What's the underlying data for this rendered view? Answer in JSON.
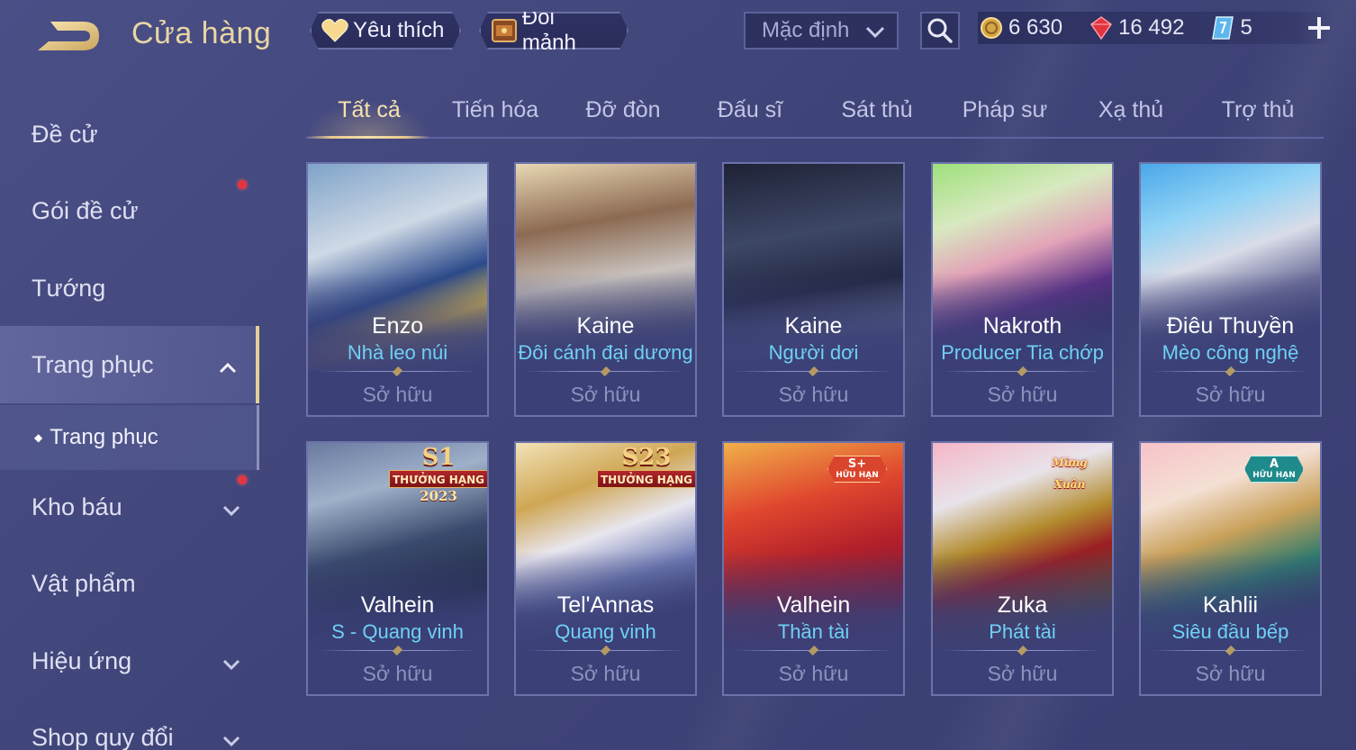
{
  "header": {
    "title": "Cửa hàng",
    "favorite_label": "Yêu thích",
    "exchange_label": "Đổi mảnh",
    "sort_selected": "Mặc định",
    "currencies": [
      {
        "icon": "gold-coin-icon",
        "value": "6 630"
      },
      {
        "icon": "red-gem-icon",
        "value": "16 492"
      },
      {
        "icon": "ticket-icon",
        "value": "5"
      }
    ]
  },
  "sidebar": {
    "items": [
      {
        "label": "Đề cử",
        "has_dot": false
      },
      {
        "label": "Gói đề cử",
        "has_dot": true
      },
      {
        "label": "Tướng",
        "has_dot": false
      },
      {
        "label": "Trang phục",
        "has_dot": false,
        "expanded": true,
        "active": true
      },
      {
        "label": "Kho báu",
        "has_dot": true
      },
      {
        "label": "Vật phẩm",
        "has_dot": false
      },
      {
        "label": "Hiệu ứng",
        "has_dot": false
      },
      {
        "label": "Shop quy đổi",
        "has_dot": false
      }
    ],
    "sub_item": "Trang phục"
  },
  "tabs": [
    "Tất cả",
    "Tiến hóa",
    "Đỡ đòn",
    "Đấu sĩ",
    "Sát thủ",
    "Pháp sư",
    "Xạ thủ",
    "Trợ thủ"
  ],
  "active_tab": 0,
  "cards": [
    {
      "hero": "Enzo",
      "skin": "Nhà leo núi",
      "status": "Sở hữu",
      "badge": null
    },
    {
      "hero": "Kaine",
      "skin": "Đôi cánh đại dương",
      "status": "Sở hữu",
      "badge": null
    },
    {
      "hero": "Kaine",
      "skin": "Người dơi",
      "status": "Sở hữu",
      "badge": null
    },
    {
      "hero": "Nakroth",
      "skin": "Producer Tia chớp",
      "status": "Sở hữu",
      "badge": null
    },
    {
      "hero": "Điêu Thuyền",
      "skin": "Mèo công nghệ",
      "status": "Sở hữu",
      "badge": null
    },
    {
      "hero": "Valhein",
      "skin": "S - Quang vinh",
      "status": "Sở hữu",
      "badge": {
        "type": "season",
        "num": "S1",
        "ribbon": "THƯỞNG HẠNG",
        "year": "2023"
      }
    },
    {
      "hero": "Tel'Annas",
      "skin": "Quang vinh",
      "status": "Sở hữu",
      "badge": {
        "type": "season",
        "num": "S23",
        "ribbon": "THƯỞNG HẠNG",
        "year": ""
      }
    },
    {
      "hero": "Valhein",
      "skin": "Thần tài",
      "status": "Sở hữu",
      "badge": {
        "type": "hex",
        "r1": "S+",
        "r2": "HỮU HẠN",
        "color": "#d9452c"
      }
    },
    {
      "hero": "Zuka",
      "skin": "Phát tài",
      "status": "Sở hữu",
      "badge": {
        "type": "tet",
        "text": "Mừng Xuân"
      }
    },
    {
      "hero": "Kahlii",
      "skin": "Siêu đầu bếp",
      "status": "Sở hữu",
      "badge": {
        "type": "hex",
        "r1": "A",
        "r2": "HỮU HẠN",
        "color": "#1f8a8c"
      }
    }
  ],
  "colors": {
    "accent_gold": "#e9d5a4",
    "skin_name": "#6fd0f6",
    "notification": "#e5343e"
  }
}
